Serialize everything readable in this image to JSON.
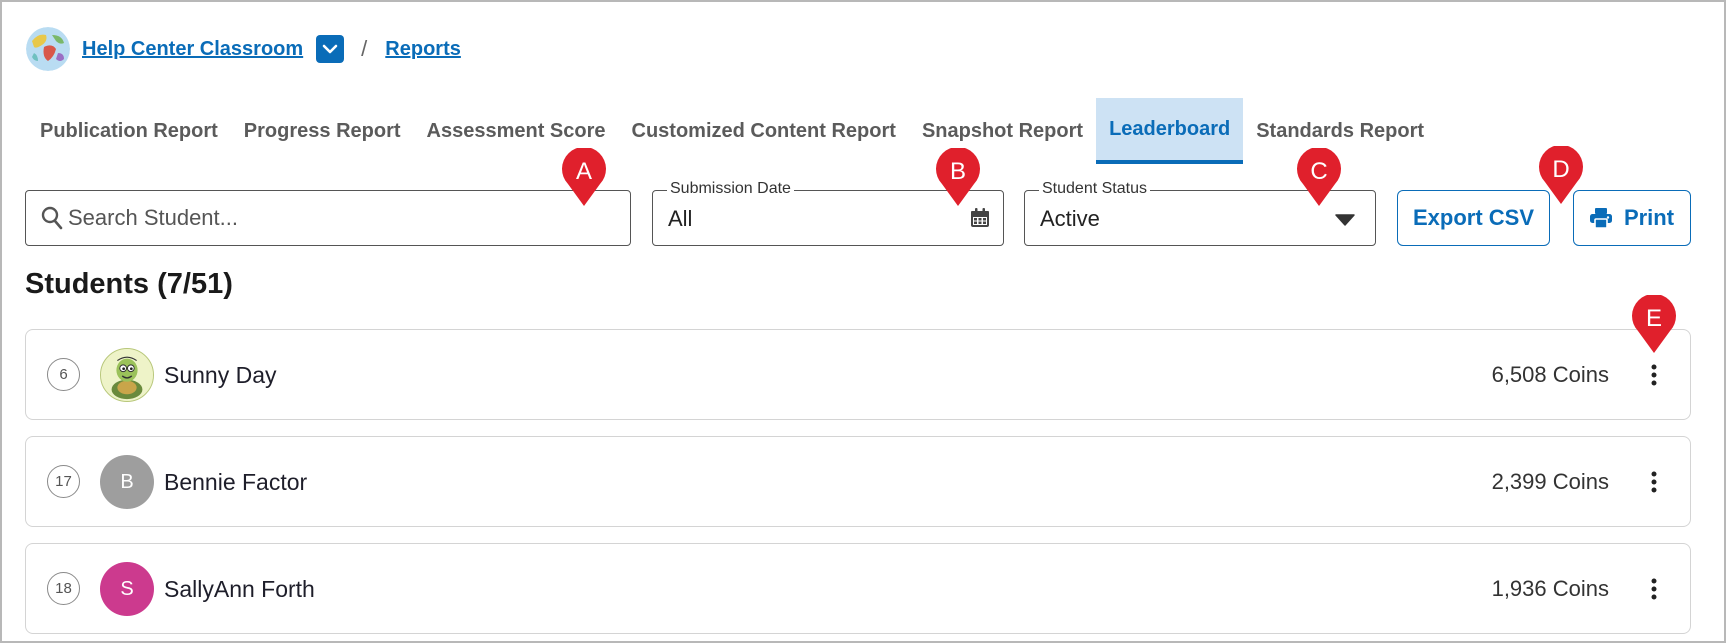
{
  "breadcrumb": {
    "classroom": "Help Center Classroom",
    "separator": "/",
    "reports": "Reports"
  },
  "tabs": [
    {
      "label": "Publication Report",
      "active": false
    },
    {
      "label": "Progress Report",
      "active": false
    },
    {
      "label": "Assessment Score",
      "active": false
    },
    {
      "label": "Customized Content Report",
      "active": false
    },
    {
      "label": "Snapshot Report",
      "active": false
    },
    {
      "label": "Leaderboard",
      "active": true
    },
    {
      "label": "Standards Report",
      "active": false
    }
  ],
  "filters": {
    "search_placeholder": "Search Student...",
    "submission_date": {
      "label": "Submission Date",
      "value": "All"
    },
    "student_status": {
      "label": "Student Status",
      "value": "Active"
    }
  },
  "actions": {
    "export_csv": "Export CSV",
    "print": "Print"
  },
  "section_title": "Students (7/51)",
  "students": [
    {
      "rank": "6",
      "name": "Sunny Day",
      "coins": "6,508 Coins",
      "avatar": "turtle-image",
      "initial": ""
    },
    {
      "rank": "17",
      "name": "Bennie Factor",
      "coins": "2,399 Coins",
      "avatar": "initial",
      "initial": "B"
    },
    {
      "rank": "18",
      "name": "SallyAnn Forth",
      "coins": "1,936 Coins",
      "avatar": "initial",
      "initial": "S"
    }
  ],
  "callouts": [
    "A",
    "B",
    "C",
    "D",
    "E"
  ],
  "colors": {
    "accent": "#0a6cb8",
    "active_tab_bg": "#cde2f4",
    "callout": "#e0202c",
    "avatar_b": "#9e9e9e",
    "avatar_s": "#cc3a8e"
  }
}
